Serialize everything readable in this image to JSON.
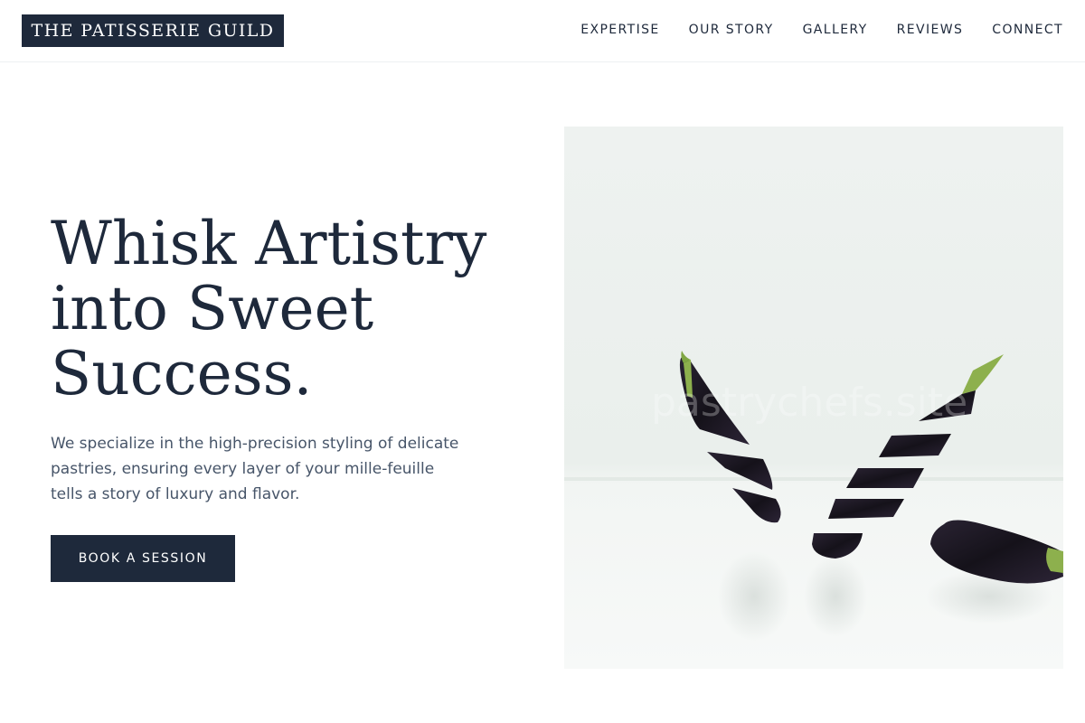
{
  "brand": {
    "name": "THE PATISSERIE GUILD"
  },
  "nav": {
    "items": [
      {
        "label": "EXPERTISE"
      },
      {
        "label": "OUR STORY"
      },
      {
        "label": "GALLERY"
      },
      {
        "label": "REVIEWS"
      },
      {
        "label": "CONNECT"
      }
    ]
  },
  "hero": {
    "title_lines": [
      "Whisk Artistry",
      "into Sweet",
      "Success."
    ],
    "subtitle": "We specialize in the high-precision styling of delicate pastries, ensuring every layer of your mille-feuille tells a story of luxury and flavor.",
    "cta_label": "BOOK A SESSION",
    "image": {
      "subject": "sliced-eggplant-photo",
      "watermark": "pastrychefs.site"
    }
  },
  "colors": {
    "brand_navy": "#1e293b",
    "body_text": "#475569",
    "background": "#ffffff",
    "photo_background": "#eef2f0",
    "eggplant": "#1a1620",
    "stem_green": "#7fa642"
  }
}
